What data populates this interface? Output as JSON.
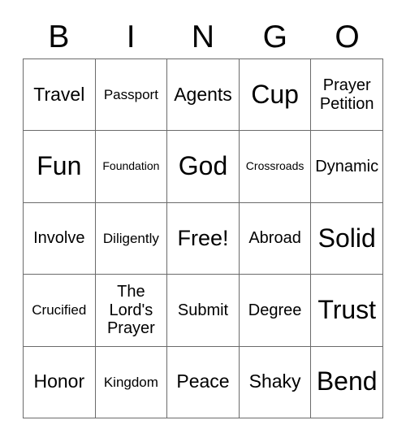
{
  "card": {
    "header_letters": [
      "B",
      "I",
      "N",
      "G",
      "O"
    ],
    "columns": 5,
    "rows": 5,
    "border_color": "#6b6b6b",
    "text_color": "#000000",
    "background_color": "#ffffff",
    "free_space_label": "Free!",
    "free_space_position": "center",
    "cells": [
      {
        "text": "Travel",
        "size": "lg"
      },
      {
        "text": "Passport",
        "size": "sm"
      },
      {
        "text": "Agents",
        "size": "lg"
      },
      {
        "text": "Cup",
        "size": "xxl"
      },
      {
        "text": "Prayer\nPetition",
        "size": "md"
      },
      {
        "text": "Fun",
        "size": "xxl"
      },
      {
        "text": "Foundation",
        "size": "xs"
      },
      {
        "text": "God",
        "size": "xxl"
      },
      {
        "text": "Crossroads",
        "size": "xs"
      },
      {
        "text": "Dynamic",
        "size": "md"
      },
      {
        "text": "Involve",
        "size": "md"
      },
      {
        "text": "Diligently",
        "size": "sm"
      },
      {
        "text": "Free!",
        "size": "xl"
      },
      {
        "text": "Abroad",
        "size": "md"
      },
      {
        "text": "Solid",
        "size": "xxl"
      },
      {
        "text": "Crucified",
        "size": "sm"
      },
      {
        "text": "The\nLord's\nPrayer",
        "size": "md"
      },
      {
        "text": "Submit",
        "size": "md"
      },
      {
        "text": "Degree",
        "size": "md"
      },
      {
        "text": "Trust",
        "size": "xxl"
      },
      {
        "text": "Honor",
        "size": "lg"
      },
      {
        "text": "Kingdom",
        "size": "sm"
      },
      {
        "text": "Peace",
        "size": "lg"
      },
      {
        "text": "Shaky",
        "size": "lg"
      },
      {
        "text": "Bend",
        "size": "xxl"
      }
    ]
  }
}
